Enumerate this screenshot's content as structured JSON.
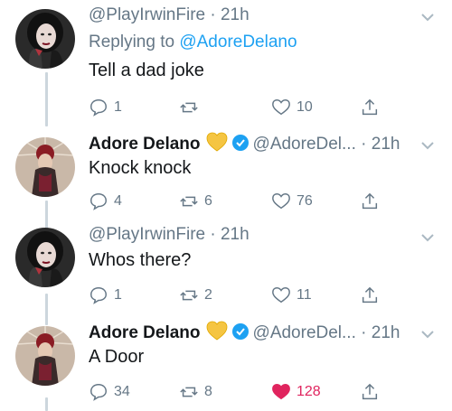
{
  "tweets": [
    {
      "handle": "@PlayIrwinFire",
      "separator": "·",
      "time": "21h",
      "replying_prefix": "Replying to",
      "replying_mention": "@AdoreDelano",
      "text": "Tell a dad joke",
      "reply_count": "1",
      "retweet_count": "",
      "like_count": "10",
      "liked": false,
      "avatar_icon": "avatar-playirwinfire"
    },
    {
      "name": "Adore Delano",
      "handle": "@AdoreDel...",
      "separator": "·",
      "time": "21h",
      "text": "Knock knock",
      "reply_count": "4",
      "retweet_count": "6",
      "like_count": "76",
      "liked": false,
      "avatar_icon": "avatar-adoredelano"
    },
    {
      "handle": "@PlayIrwinFire",
      "separator": "·",
      "time": "21h",
      "text": "Whos there?",
      "reply_count": "1",
      "retweet_count": "2",
      "like_count": "11",
      "liked": false,
      "avatar_icon": "avatar-playirwinfire"
    },
    {
      "name": "Adore Delano",
      "handle": "@AdoreDel...",
      "separator": "·",
      "time": "21h",
      "text": "A Door",
      "reply_count": "34",
      "retweet_count": "8",
      "like_count": "128",
      "liked": true,
      "avatar_icon": "avatar-adoredelano"
    }
  ],
  "colors": {
    "text": "#14171a",
    "secondary": "#657786",
    "link": "#1da1f2",
    "like": "#e0245e",
    "heart_emoji": "#f5c542",
    "verified": "#1da1f2",
    "thread_line": "#ccd6dd"
  }
}
